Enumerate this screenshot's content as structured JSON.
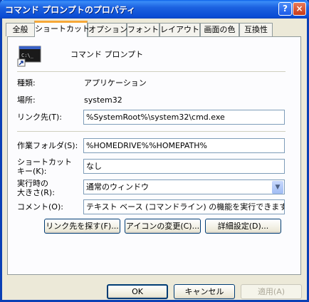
{
  "window": {
    "title": "コマンド プロンプトのプロパティ",
    "help_icon": "?",
    "close_icon": "×"
  },
  "tabs": [
    {
      "label": "全般"
    },
    {
      "label": "ショートカット",
      "active": true
    },
    {
      "label": "オプション"
    },
    {
      "label": "フォント"
    },
    {
      "label": "レイアウト"
    },
    {
      "label": "画面の色"
    },
    {
      "label": "互換性"
    }
  ],
  "shortcut": {
    "name": "コマンド プロンプト",
    "icon": "console-icon",
    "icon_text": "C:\\_",
    "type_label": "種類:",
    "type_value": "アプリケーション",
    "location_label": "場所:",
    "location_value": "system32",
    "target_label": "リンク先(T):",
    "target_value": "%SystemRoot%\\system32\\cmd.exe",
    "startin_label": "作業フォルダ(S):",
    "startin_value": "%HOMEDRIVE%%HOMEPATH%",
    "hotkey_label_1": "ショートカット",
    "hotkey_label_2": "キー(K):",
    "hotkey_value": "なし",
    "run_label_1": "実行時の",
    "run_label_2": "大きさ(R):",
    "run_value": "通常のウィンドウ",
    "comment_label": "コメント(O):",
    "comment_value": "テキスト ベース (コマンドライン) の機能を実行できます。",
    "find_target_button": "リンク先を探す(F)...",
    "change_icon_button": "アイコンの変更(C)...",
    "advanced_button": "詳細設定(D)..."
  },
  "footer": {
    "ok": "OK",
    "cancel": "キャンセル",
    "apply": "適用(A)"
  }
}
